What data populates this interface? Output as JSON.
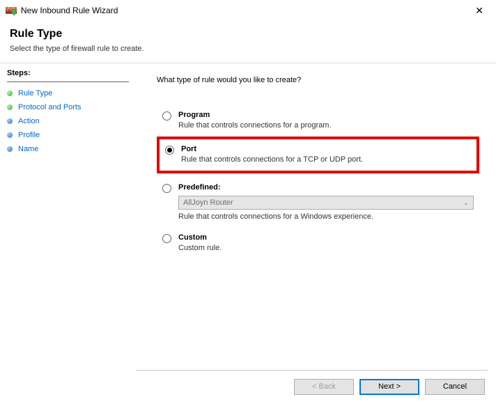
{
  "window": {
    "title": "New Inbound Rule Wizard"
  },
  "header": {
    "title": "Rule Type",
    "subtitle": "Select the type of firewall rule to create."
  },
  "sidebar": {
    "steps_label": "Steps:",
    "items": [
      {
        "label": "Rule Type",
        "active": true
      },
      {
        "label": "Protocol and Ports",
        "active": true
      },
      {
        "label": "Action",
        "active": false
      },
      {
        "label": "Profile",
        "active": false
      },
      {
        "label": "Name",
        "active": false
      }
    ]
  },
  "content": {
    "prompt": "What type of rule would you like to create?",
    "options": {
      "program": {
        "label": "Program",
        "desc": "Rule that controls connections for a program."
      },
      "port": {
        "label": "Port",
        "desc": "Rule that controls connections for a TCP or UDP port."
      },
      "predefined": {
        "label": "Predefined:",
        "selected": "AllJoyn Router",
        "desc": "Rule that controls connections for a Windows experience."
      },
      "custom": {
        "label": "Custom",
        "desc": "Custom rule."
      }
    }
  },
  "footer": {
    "back": "< Back",
    "next": "Next >",
    "cancel": "Cancel"
  }
}
